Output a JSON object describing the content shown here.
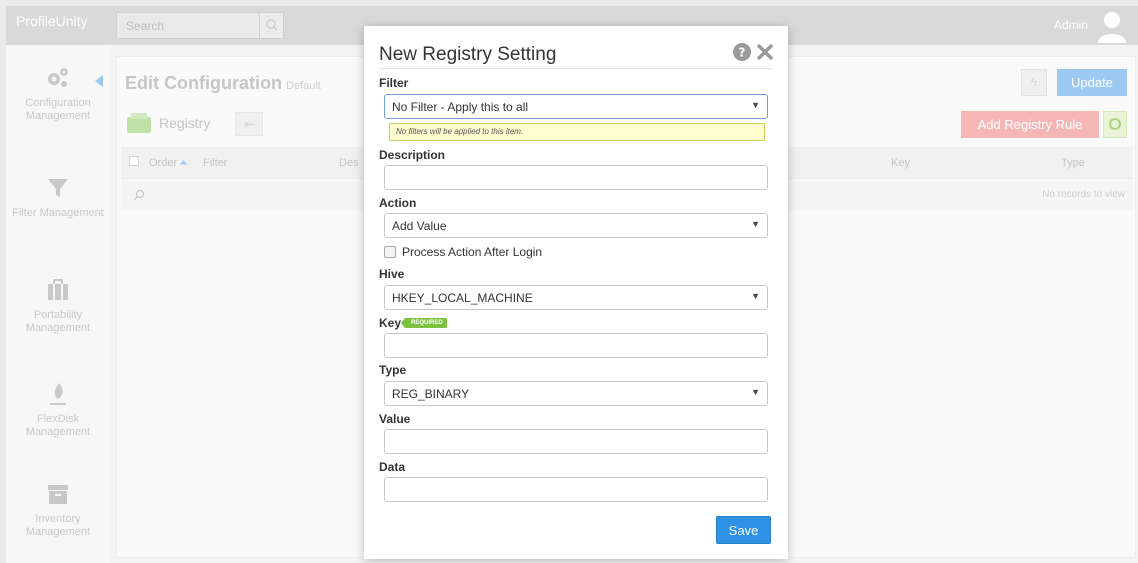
{
  "app": {
    "brand": "ProfileUnity",
    "search_placeholder": "Search",
    "user": "Admin"
  },
  "sidebar": {
    "items": [
      {
        "label": "Configuration Management",
        "icon": "gears-icon"
      },
      {
        "label": "Filter Management",
        "icon": "funnel-icon"
      },
      {
        "label": "Portability Management",
        "icon": "briefcase-icon"
      },
      {
        "label": "FlexDisk Management",
        "icon": "flame-icon"
      },
      {
        "label": "Inventory Management",
        "icon": "archive-box-icon"
      }
    ]
  },
  "page": {
    "title": "Edit Configuration",
    "subtitle": "Default",
    "update_label": "Update",
    "section": "Registry",
    "add_rule_label": "Add Registry Rule",
    "columns": [
      "Order",
      "Filter",
      "Des",
      "Key",
      "Type"
    ],
    "empty_text": "No records to view"
  },
  "modal": {
    "title": "New Registry Setting",
    "filter_label": "Filter",
    "filter_value": "No Filter - Apply this to all",
    "filter_hint": "No filters will be applied to this item.",
    "description_label": "Description",
    "description_value": "",
    "action_label": "Action",
    "action_value": "Add Value",
    "process_after_login_label": "Process Action After Login",
    "process_after_login_checked": false,
    "hive_label": "Hive",
    "hive_value": "HKEY_LOCAL_MACHINE",
    "key_label": "Key",
    "required_badge": "REQUIRED",
    "key_value": "",
    "type_label": "Type",
    "type_value": "REG_BINARY",
    "value_label": "Value",
    "value_value": "",
    "data_label": "Data",
    "data_value": "",
    "save_label": "Save"
  },
  "colors": {
    "accent": "#2e93e6",
    "required_green": "#7cc142",
    "hint_bg": "#fdfdcf"
  }
}
